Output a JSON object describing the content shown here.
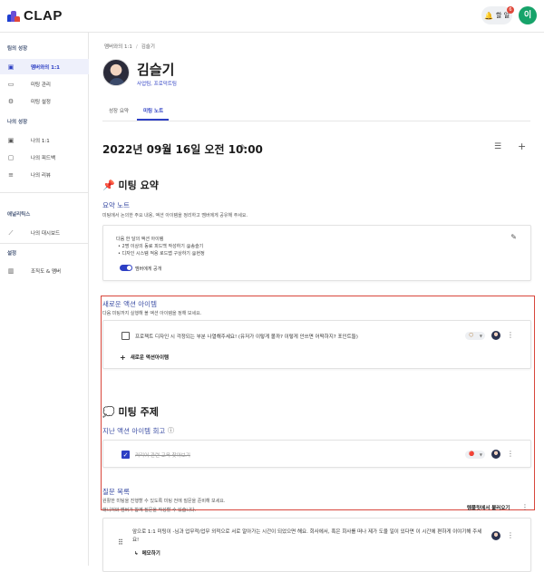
{
  "app": {
    "logo_text": "CLAP",
    "brand_colors": [
      "#1e3fd0",
      "#e0483a",
      "#6a4fd6"
    ]
  },
  "header": {
    "notifications_label": "할 일",
    "notifications_count": "6",
    "user_initial": "이"
  },
  "sidebar": {
    "sections": [
      {
        "title": "팀의 성장",
        "items": [
          {
            "label": "멤버와의 1:1",
            "icon": "person-card-icon",
            "active": true
          },
          {
            "label": "미팅 관리",
            "icon": "calendar-icon",
            "active": false
          },
          {
            "label": "미팅 설정",
            "icon": "gear-icon",
            "active": false
          }
        ]
      },
      {
        "title": "나의 성장",
        "items": [
          {
            "label": "나의 1:1",
            "icon": "person-card-icon",
            "active": false
          },
          {
            "label": "나의 피드백",
            "icon": "chat-bubble-icon",
            "active": false
          },
          {
            "label": "나의 리뷰",
            "icon": "list-icon",
            "active": false
          }
        ]
      },
      {
        "title": "애널리틱스",
        "items": [
          {
            "label": "나의 대시보드",
            "icon": "trend-icon",
            "active": false
          }
        ]
      },
      {
        "title": "설정",
        "items": [
          {
            "label": "조직도 & 멤버",
            "icon": "building-icon",
            "active": false
          }
        ]
      }
    ]
  },
  "breadcrumb": {
    "parent": "멤버와의 1:1",
    "sep": "/",
    "current": "김슬기"
  },
  "profile": {
    "name": "김슬기",
    "team": "사업팀, 프로덕트팀"
  },
  "tabs": [
    {
      "label": "성장 요약",
      "active": false
    },
    {
      "label": "미팅 노트",
      "active": true
    }
  ],
  "meeting": {
    "title": "2022년 09월 16일 오전 10:00",
    "summary_heading": "📌 미팅 요약",
    "summary_note": {
      "heading": "요약 노트",
      "desc": "미팅에서 논의한 주요 내용, 액션 아이템을 정리하고 멤버에게 공유해 주세요.",
      "lines": [
        "다음 한 달의 액션 아이템",
        "• 2명 이상의 동료 피드백 작성하기 @송슬기",
        "• 디자인 시스템 적용 로드맵 구상하기 @현정"
      ],
      "share_label": "멤버에게 공개",
      "share_on": true
    },
    "new_actions": {
      "heading": "새로운 액션 아이템",
      "desc": "다음 미팅까지 실행해 볼 액션 아이템을 정해 보세요.",
      "items": [
        {
          "text": "프로젝트 디자인 시 걱정되는 부분 나열해주세요! (유저가 이렇게 볼까? 이렇게 안쓰면 어떡하지? 포인트들)",
          "checked": false,
          "tag": "🌕"
        }
      ],
      "add_label": "새로운 액션아이템"
    },
    "topics": {
      "heading": "💭 미팅 주제",
      "past_heading": "지난 액션 아이템 회고",
      "past_items": [
        {
          "text": "커리어 관련 교육 찾아보기",
          "checked": true,
          "tag": "🔴"
        }
      ]
    },
    "questions": {
      "heading": "질문 목록",
      "desc1": "원활한 미팅을 진행할 수 있도록 미팅 전에 질문을 준비해 보세요.",
      "desc2": "매니저와 멤버가 함께 질문을 작성할 수 있습니다.",
      "template_label": "템플릿에서 불러오기",
      "items": [
        {
          "text_line1": "앞으로 1:1 미팅이 -님과 업무적/업무 외적으로 서로 알아가는 시간이 되었으면 해요. 회사에서, 혹은 회사를 떠나 제가 도울 일이 있다면 이 시간에 편하게 이야기해 주세",
          "text_line2": "요!",
          "reply_label": "메모하기"
        }
      ]
    }
  }
}
